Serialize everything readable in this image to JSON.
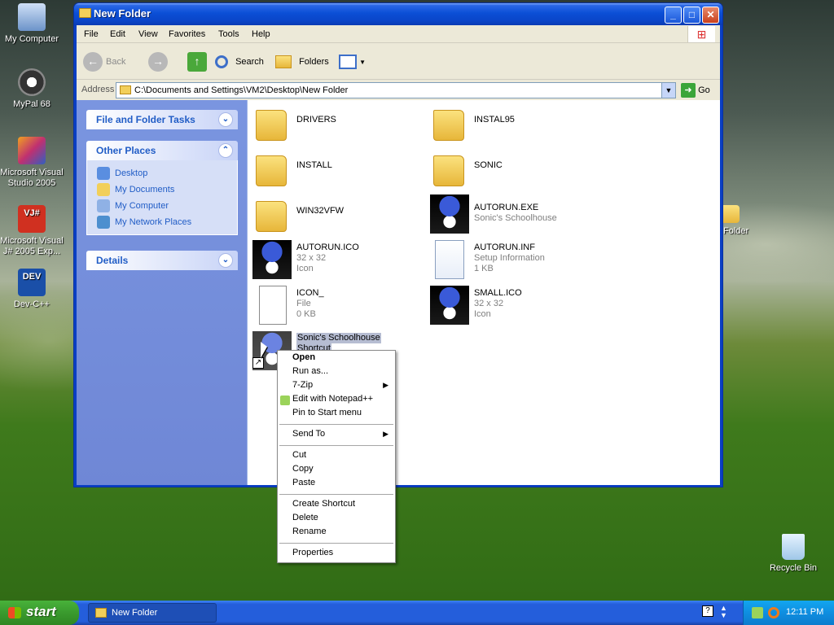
{
  "desktop": {
    "icons": [
      {
        "label": "My Computer"
      },
      {
        "label": "MyPal 68"
      },
      {
        "label": "Microsoft Visual Studio 2005"
      },
      {
        "label": "Microsoft Visual J# 2005 Exp..."
      },
      {
        "label": "Dev-C++"
      },
      {
        "label": "Folder"
      },
      {
        "label": "Recycle Bin"
      }
    ]
  },
  "window": {
    "title": "New Folder",
    "menu": [
      "File",
      "Edit",
      "View",
      "Favorites",
      "Tools",
      "Help"
    ],
    "toolbar": {
      "back": "Back",
      "search": "Search",
      "folders": "Folders"
    },
    "address": {
      "label": "Address",
      "value": "C:\\Documents and Settings\\VM2\\Desktop\\New Folder",
      "go": "Go"
    }
  },
  "taskpane": {
    "file_tasks": "File and Folder Tasks",
    "other_places": "Other Places",
    "places": [
      "Desktop",
      "My Documents",
      "My Computer",
      "My Network Places"
    ],
    "details": "Details"
  },
  "files": [
    {
      "name": "DRIVERS",
      "line2": "",
      "line3": "",
      "type": "folder"
    },
    {
      "name": "INSTAL95",
      "line2": "",
      "line3": "",
      "type": "folder"
    },
    {
      "name": "INSTALL",
      "line2": "",
      "line3": "",
      "type": "folder"
    },
    {
      "name": "SONIC",
      "line2": "",
      "line3": "",
      "type": "folder"
    },
    {
      "name": "WIN32VFW",
      "line2": "",
      "line3": "",
      "type": "folder"
    },
    {
      "name": "AUTORUN.EXE",
      "line2": "Sonic's Schoolhouse",
      "line3": "",
      "type": "sonic"
    },
    {
      "name": "AUTORUN.ICO",
      "line2": "32 x 32",
      "line3": "Icon",
      "type": "sonic"
    },
    {
      "name": "AUTORUN.INF",
      "line2": "Setup Information",
      "line3": "1 KB",
      "type": "inf"
    },
    {
      "name": "ICON_",
      "line2": "File",
      "line3": "0 KB",
      "type": "file"
    },
    {
      "name": "SMALL.ICO",
      "line2": "32 x 32",
      "line3": "Icon",
      "type": "sonic"
    },
    {
      "name": "Sonic's Schoolhouse",
      "line2": "Shortcut",
      "line3": "",
      "type": "shortcut"
    }
  ],
  "context_menu": [
    {
      "label": "Open",
      "bold": true
    },
    {
      "label": "Run as..."
    },
    {
      "label": "7-Zip",
      "submenu": true
    },
    {
      "label": "Edit with Notepad++"
    },
    {
      "label": "Pin to Start menu"
    },
    {
      "label": "Send To",
      "submenu": true
    },
    {
      "label": "Cut"
    },
    {
      "label": "Copy"
    },
    {
      "label": "Paste"
    },
    {
      "label": "Create Shortcut"
    },
    {
      "label": "Delete"
    },
    {
      "label": "Rename"
    },
    {
      "label": "Properties"
    }
  ],
  "taskbar": {
    "start": "start",
    "app": "New Folder",
    "clock": "12:11 PM"
  },
  "colors": {
    "titlebar": "#0b4fd6",
    "taskpane": "#6f87d6",
    "link": "#215dc6",
    "taskbar": "#245edb",
    "start": "#3a9a2e"
  }
}
